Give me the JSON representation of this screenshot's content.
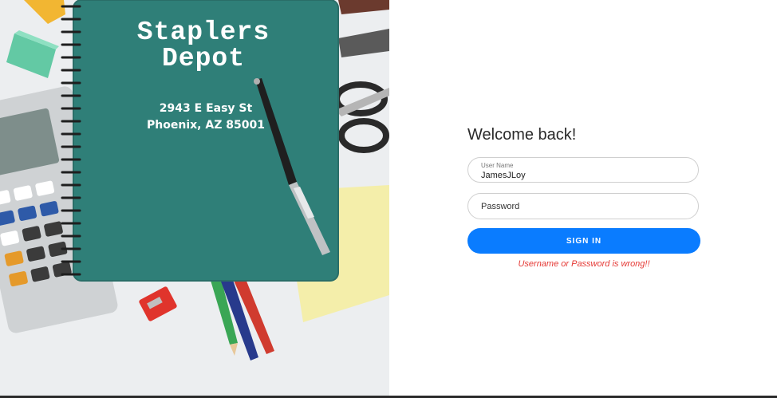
{
  "hero": {
    "store_name_line1": "Staplers",
    "store_name_line2": "Depot",
    "address_line1": "2943 E Easy St",
    "address_line2": "Phoenix, AZ 85001"
  },
  "login": {
    "welcome": "Welcome back!",
    "username_label": "User Name",
    "username_value": "JamesJLoy",
    "password_placeholder": "Password",
    "signin_label": "SIGN IN",
    "error_message": "Username or Password is wrong!!"
  },
  "colors": {
    "notebook": "#2f7f78",
    "signin_button": "#0a7cff",
    "error_text": "#e53935"
  }
}
